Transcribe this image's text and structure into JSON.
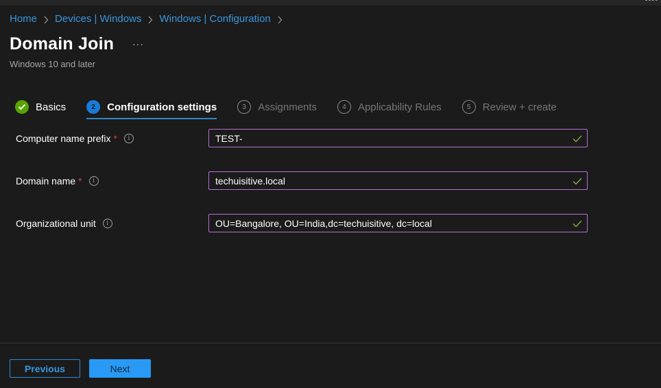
{
  "topbar": {
    "fragment": "••••"
  },
  "breadcrumb": [
    {
      "label": "Home"
    },
    {
      "label": "Devices | Windows"
    },
    {
      "label": "Windows | Configuration"
    }
  ],
  "header": {
    "title": "Domain Join",
    "more": "···",
    "subtitle": "Windows 10 and later"
  },
  "steps": [
    {
      "number": "1",
      "label": "Basics",
      "state": "done"
    },
    {
      "number": "2",
      "label": "Configuration settings",
      "state": "current"
    },
    {
      "number": "3",
      "label": "Assignments",
      "state": "pending"
    },
    {
      "number": "4",
      "label": "Applicability Rules",
      "state": "pending"
    },
    {
      "number": "5",
      "label": "Review + create",
      "state": "pending"
    }
  ],
  "form": {
    "fields": [
      {
        "label": "Computer name prefix",
        "required": true,
        "value": "TEST-",
        "valid": true
      },
      {
        "label": "Domain name",
        "required": true,
        "value": "techuisitive.local",
        "valid": true
      },
      {
        "label": "Organizational unit",
        "required": false,
        "value": "OU=Bangalore, OU=India,dc=techuisitive, dc=local",
        "valid": true
      }
    ],
    "required_marker": "*",
    "info_glyph": "i"
  },
  "footer": {
    "previous_label": "Previous",
    "next_label": "Next"
  },
  "colors": {
    "accent": "#3a96dd",
    "step_done": "#57a300",
    "step_current": "#1a7ad8",
    "field_border": "#b870d6",
    "valid_check": "#a7c04a",
    "required": "#e23a3a",
    "primary_button": "#2899f5"
  }
}
